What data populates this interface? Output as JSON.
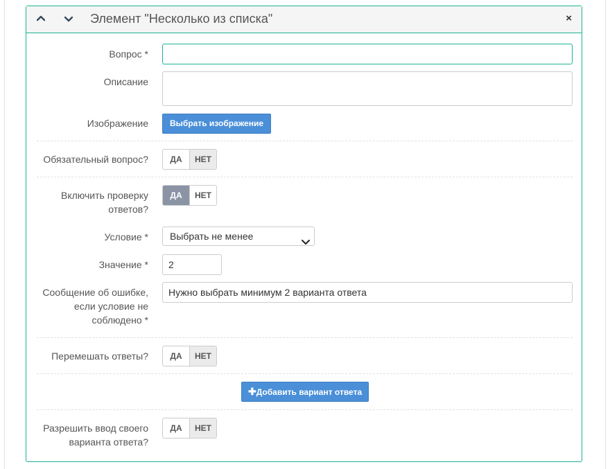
{
  "panel": {
    "title": "Элемент \"Несколько из списка\"",
    "close_label": "×"
  },
  "fields": {
    "question_label": "Вопрос *",
    "question_value": "",
    "description_label": "Описание",
    "description_value": "",
    "image_label": "Изображение",
    "image_button": "Выбрать изображение",
    "required_label": "Обязательный вопрос?",
    "check_label_1": "Включить проверку",
    "check_label_2": "ответов?",
    "condition_label": "Условие *",
    "condition_value": "Выбрать не менее",
    "value_label": "Значение *",
    "value_value": "2",
    "error_label_1": "Сообщение об ошибке,",
    "error_label_2": "если условие не",
    "error_label_3": "соблюдено *",
    "error_value": "Нужно выбрать минимум 2 варианта ответа",
    "shuffle_label": "Перемешать ответы?",
    "add_option_button": "Добавить вариант ответа",
    "own_label_1": "Разрешить ввод своего",
    "own_label_2": "варианта ответа?"
  },
  "toggle": {
    "yes": "ДА",
    "no": "НЕТ"
  },
  "states": {
    "required": "НЕТ",
    "check": "ДА",
    "shuffle": "НЕТ",
    "own": "НЕТ"
  },
  "icons": {
    "collapse": "chevron-up-icon",
    "expand": "chevron-down-icon",
    "close": "close-icon",
    "add": "plus-icon",
    "select": "chevron-down-icon"
  },
  "colors": {
    "accent": "#1ab394",
    "primary_button": "#4a8fd8",
    "toggle_active": "#8a94a5"
  }
}
